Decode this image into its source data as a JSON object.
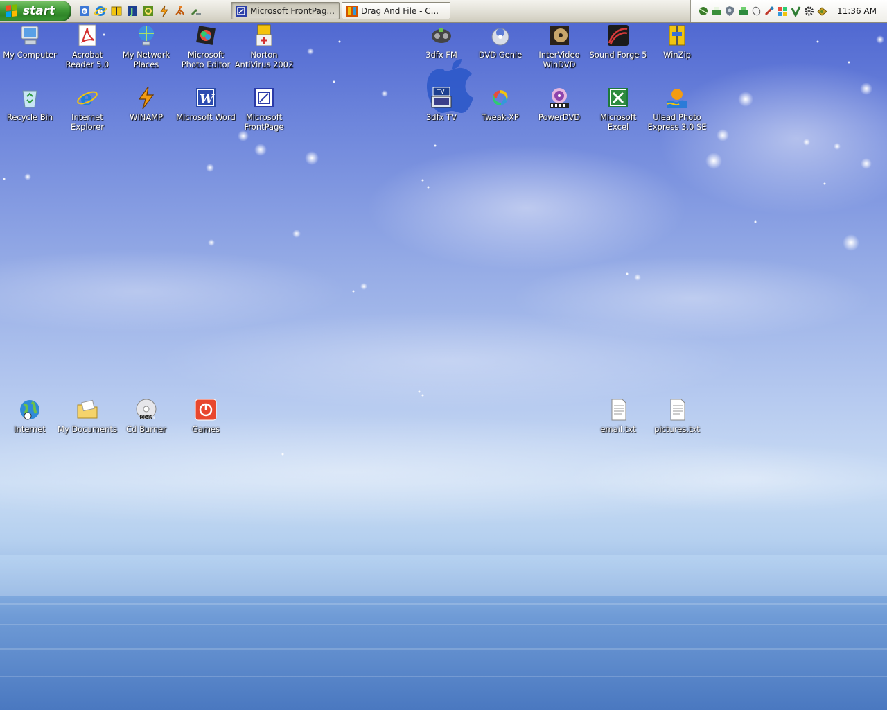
{
  "taskbar": {
    "start_label": "start",
    "quick_launch": [
      {
        "name": "show-desktop-icon"
      },
      {
        "name": "internet-explorer-icon"
      },
      {
        "name": "winzip-icon"
      },
      {
        "name": "j-icon"
      },
      {
        "name": "refresh-icon"
      },
      {
        "name": "winamp-icon"
      },
      {
        "name": "runner-icon"
      },
      {
        "name": "tools-icon"
      }
    ],
    "tasks": [
      {
        "label": "Microsoft FrontPag...",
        "icon": "frontpage-icon",
        "state": "active"
      },
      {
        "label": "Drag And File  -  C...",
        "icon": "drag-and-file-icon",
        "state": "inactive"
      }
    ],
    "tray_icons": [
      "network-icon",
      "printer-icon",
      "shield-icon",
      "sync-icon",
      "mouse-icon",
      "tool-icon",
      "volume-icon",
      "antivirus-icon",
      "gear-icon",
      "messenger-icon"
    ],
    "clock": "11:36 AM"
  },
  "desktop": {
    "icons": [
      {
        "id": "my-computer",
        "label": "My Computer",
        "icon": "computer-icon"
      },
      {
        "id": "acrobat-reader",
        "label": "Acrobat Reader 5.0",
        "icon": "acrobat-icon"
      },
      {
        "id": "my-network-places",
        "label": "My Network Places",
        "icon": "network-places-icon"
      },
      {
        "id": "photo-editor",
        "label": "Microsoft Photo Editor",
        "icon": "photo-editor-icon"
      },
      {
        "id": "norton-antivirus",
        "label": "Norton AntiVirus 2002",
        "icon": "norton-icon"
      },
      {
        "id": "3dfx-fm",
        "label": "3dfx FM",
        "icon": "radio-icon"
      },
      {
        "id": "dvd-genie",
        "label": "DVD Genie",
        "icon": "dvd-genie-icon"
      },
      {
        "id": "intervideo-windvd",
        "label": "InterVideo WinDVD",
        "icon": "windvd-icon"
      },
      {
        "id": "sound-forge",
        "label": "Sound Forge 5",
        "icon": "sound-forge-icon"
      },
      {
        "id": "winzip",
        "label": "WinZip",
        "icon": "winzip-icon"
      },
      {
        "id": "recycle-bin",
        "label": "Recycle Bin",
        "icon": "recycle-bin-icon"
      },
      {
        "id": "internet-explorer",
        "label": "Internet Explorer",
        "icon": "internet-explorer-icon"
      },
      {
        "id": "winamp",
        "label": "WINAMP",
        "icon": "winamp-icon"
      },
      {
        "id": "microsoft-word",
        "label": "Microsoft Word",
        "icon": "word-icon"
      },
      {
        "id": "microsoft-frontpage",
        "label": "Microsoft FrontPage",
        "icon": "frontpage-icon"
      },
      {
        "id": "3dfx-tv",
        "label": "3dfx TV",
        "icon": "tv-icon"
      },
      {
        "id": "tweak-xp",
        "label": "Tweak-XP",
        "icon": "tweak-xp-icon"
      },
      {
        "id": "powerdvd",
        "label": "PowerDVD",
        "icon": "powerdvd-icon"
      },
      {
        "id": "microsoft-excel",
        "label": "Microsoft Excel",
        "icon": "excel-icon"
      },
      {
        "id": "ulead-photo-express",
        "label": "Ulead Photo Express 3.0 SE",
        "icon": "ulead-icon"
      },
      {
        "id": "internet",
        "label": "Internet",
        "icon": "globe-icon"
      },
      {
        "id": "my-documents",
        "label": "My Documents",
        "icon": "folder-icon"
      },
      {
        "id": "cd-burner",
        "label": "Cd Burner",
        "icon": "cd-icon"
      },
      {
        "id": "games",
        "label": "Games",
        "icon": "power-icon"
      },
      {
        "id": "email-txt",
        "label": "email.txt",
        "icon": "text-file-icon"
      },
      {
        "id": "pictures-txt",
        "label": "pictures.txt",
        "icon": "text-file-icon"
      }
    ]
  }
}
